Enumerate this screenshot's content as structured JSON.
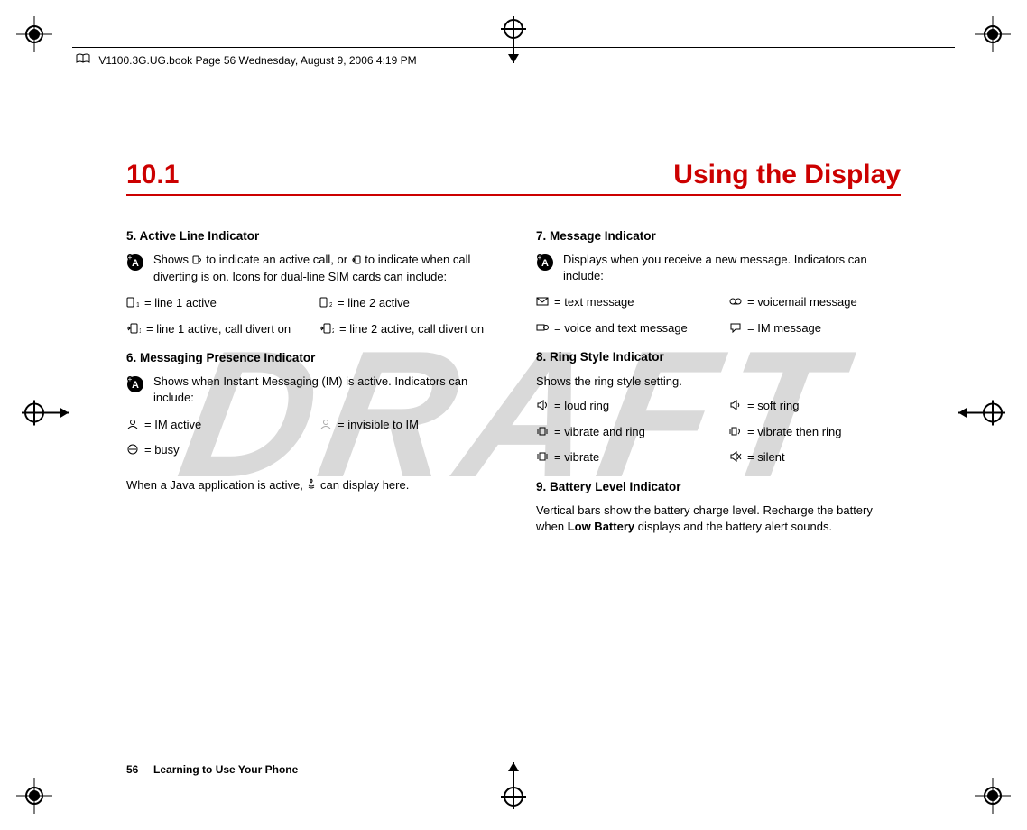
{
  "header": {
    "text": "V1100.3G.UG.book  Page 56  Wednesday, August 9, 2006  4:19 PM"
  },
  "watermark": "DRAFT",
  "section": {
    "number": "10.1",
    "title": "Using the Display"
  },
  "left": {
    "s5": {
      "heading": "5. Active Line Indicator",
      "intro_pre": "Shows ",
      "intro_mid": " to indicate an active call, or ",
      "intro_post": " to indicate when call diverting is on. Icons for dual-line SIM cards can include:",
      "items": [
        " = line 1 active",
        " = line 2 active",
        " = line 1 active, call divert on",
        " = line 2 active, call divert on"
      ]
    },
    "s6": {
      "heading": "6. Messaging Presence Indicator",
      "intro": "Shows when Instant Messaging (IM) is active. Indicators can include:",
      "items": [
        " = IM active",
        " = invisible to IM",
        " = busy",
        ""
      ],
      "java_pre": "When a Java application is active, ",
      "java_post": " can display here."
    }
  },
  "right": {
    "s7": {
      "heading": "7. Message Indicator",
      "intro": "Displays when you receive a new message. Indicators can include:",
      "items": [
        " = text message",
        " = voicemail message",
        " = voice and text message",
        " = IM message"
      ]
    },
    "s8": {
      "heading": "8. Ring Style Indicator",
      "intro": "Shows the ring style setting.",
      "items": [
        " = loud ring",
        " = soft ring",
        " = vibrate and ring",
        " = vibrate then ring",
        " = vibrate",
        " = silent"
      ]
    },
    "s9": {
      "heading": "9. Battery Level Indicator",
      "text_pre": "Vertical bars show the battery charge level. Recharge the battery when ",
      "text_bold": "Low Battery",
      "text_post": " displays and the battery alert sounds."
    }
  },
  "footer": {
    "page": "56",
    "label": "Learning to Use Your Phone"
  }
}
